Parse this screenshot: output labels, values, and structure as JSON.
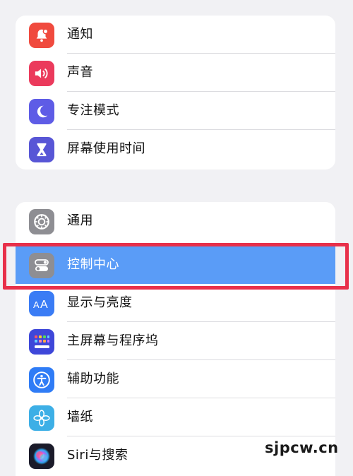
{
  "groups": [
    {
      "items": [
        {
          "label": "通知",
          "icon": "bell-icon",
          "color": "#f04a3e"
        },
        {
          "label": "声音",
          "icon": "speaker-icon",
          "color": "#eb3a5c"
        },
        {
          "label": "专注模式",
          "icon": "moon-icon",
          "color": "#5e5ce6"
        },
        {
          "label": "屏幕使用时间",
          "icon": "hourglass-icon",
          "color": "#5856d6"
        }
      ]
    },
    {
      "items": [
        {
          "label": "通用",
          "icon": "gear-icon",
          "color": "#8e8e93"
        },
        {
          "label": "控制中心",
          "icon": "toggles-icon",
          "color": "#8e8e93",
          "selected": true
        },
        {
          "label": "显示与亮度",
          "icon": "text-size-icon",
          "color": "#3a7cf5"
        },
        {
          "label": "主屏幕与程序坞",
          "icon": "home-grid-icon",
          "color": "#3e47d9"
        },
        {
          "label": "辅助功能",
          "icon": "accessibility-icon",
          "color": "#2f7cf6"
        },
        {
          "label": "墙纸",
          "icon": "flower-icon",
          "color": "#3dafe6"
        },
        {
          "label": "Siri与搜索",
          "icon": "siri-icon",
          "color": "#1b1b2a"
        }
      ]
    }
  ],
  "watermark": "sjpcw.cn",
  "highlight_color": "#e8304a",
  "selected_row_color": "#5a9cf7"
}
